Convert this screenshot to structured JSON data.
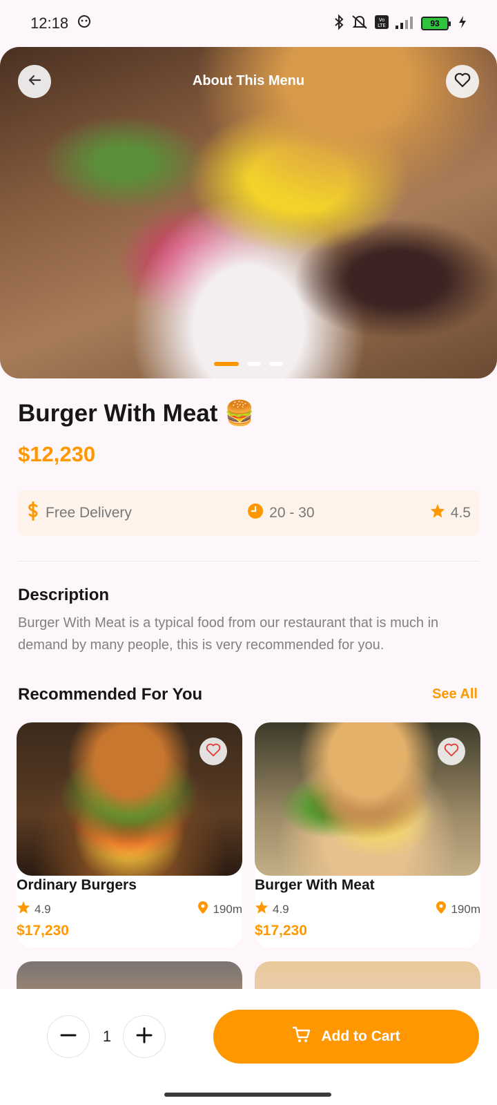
{
  "status_bar": {
    "time": "12:18",
    "battery": "93",
    "icons": [
      "bluetooth-icon",
      "mute-icon",
      "volte-icon",
      "signal-icon",
      "battery-icon",
      "charging-icon"
    ]
  },
  "header": {
    "title": "About This Menu",
    "back_icon": "arrow-left-icon",
    "favorite_icon": "heart-icon"
  },
  "hero": {
    "slide_count": 3,
    "active_slide": 1
  },
  "product": {
    "title": "Burger With Meat 🍔",
    "price": "$12,230"
  },
  "info": {
    "delivery": "Free Delivery",
    "time": "20 - 30",
    "rating": "4.5"
  },
  "description": {
    "title": "Description",
    "text": "Burger With Meat is a typical food from our restaurant that is much in demand by many people, this is very recommended for you."
  },
  "recommended": {
    "title": "Recommended For You",
    "see_all": "See All",
    "items": [
      {
        "name": "Ordinary Burgers",
        "rating": "4.9",
        "distance": "190m",
        "price": "$17,230"
      },
      {
        "name": "Burger With Meat",
        "rating": "4.9",
        "distance": "190m",
        "price": "$17,230"
      }
    ]
  },
  "cart": {
    "quantity": "1",
    "add_label": "Add to Cart"
  },
  "colors": {
    "accent": "#ff9800",
    "background": "#fdf7fc"
  }
}
